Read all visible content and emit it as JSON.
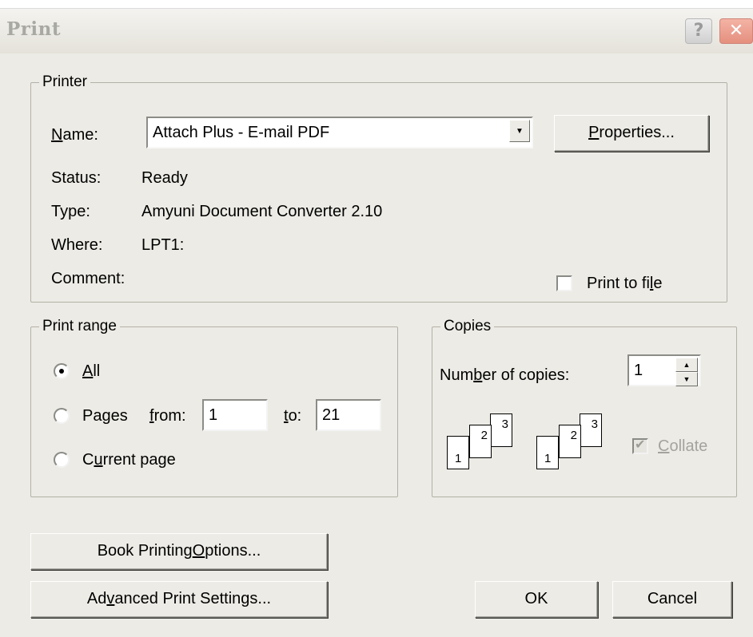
{
  "window": {
    "title": "Print",
    "help_glyph": "?",
    "close_glyph": "✕"
  },
  "printer": {
    "legend": "Printer",
    "name_label": "Name:",
    "name_value": "Attach Plus - E-mail PDF",
    "properties_button": "Properties...",
    "status_label": "Status:",
    "status_value": "Ready",
    "type_label": "Type:",
    "type_value": "Amyuni Document Converter 2.10",
    "where_label": "Where:",
    "where_value": "LPT1:",
    "comment_label": "Comment:",
    "print_to_file_label": "Print to file",
    "print_to_file_checked": false
  },
  "print_range": {
    "legend": "Print range",
    "all_label": "All",
    "pages_label": "Pages",
    "from_label": "from:",
    "from_value": "1",
    "to_label": "to:",
    "to_value": "21",
    "current_page_label": "Current page",
    "selected": "All"
  },
  "copies": {
    "legend": "Copies",
    "number_label": "Number of copies:",
    "number_value": "1",
    "collate_label": "Collate",
    "collate_checked": true,
    "collate_enabled": false,
    "page_numbers": [
      "1",
      "2",
      "3"
    ]
  },
  "buttons": {
    "book_printing": "Book Printing Options...",
    "advanced": "Advanced Print Settings...",
    "ok": "OK",
    "cancel": "Cancel"
  },
  "icons": {
    "dropdown": "▼",
    "spin_up": "▲",
    "spin_down": "▼",
    "check": "✔"
  }
}
